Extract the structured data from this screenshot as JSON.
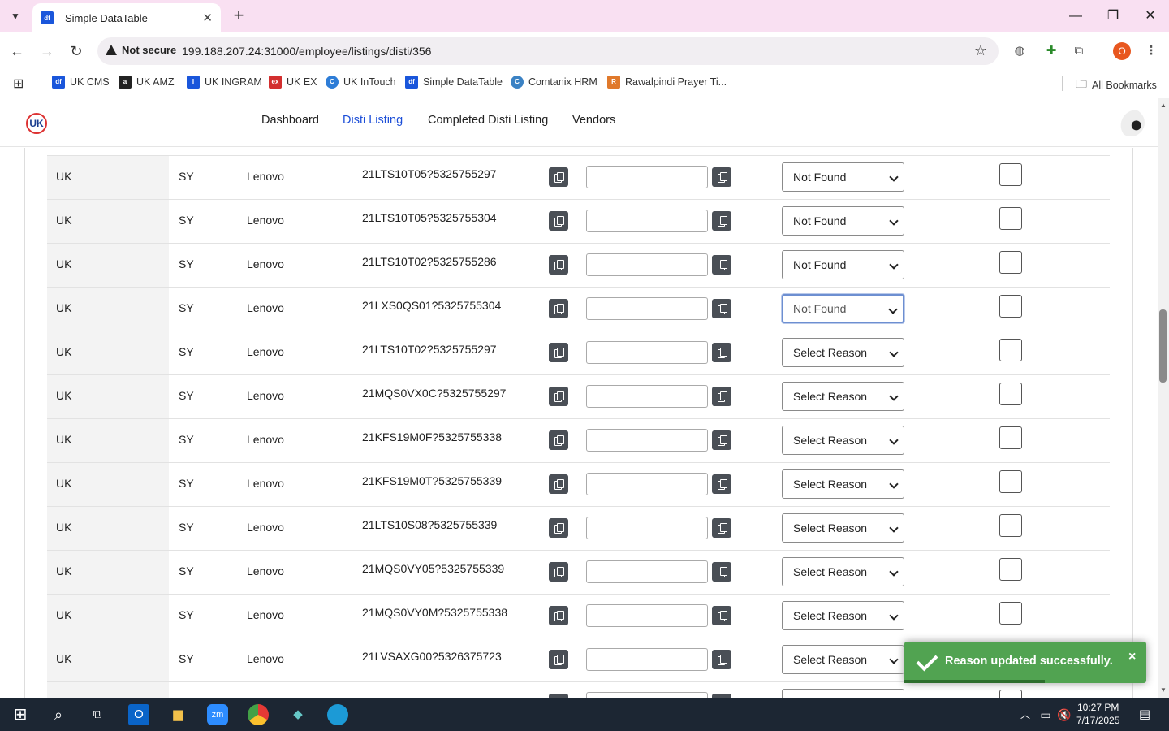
{
  "browser": {
    "tab_title": "Simple DataTable",
    "tab_favicon": "df",
    "security_label": "Not secure",
    "url": "199.188.207.24:31000/employee/listings/disti/356",
    "profile_initial": "O",
    "bookmarks": [
      {
        "label": "UK CMS",
        "icon": "df",
        "color": "#1a56db"
      },
      {
        "label": "UK AMZ",
        "icon": "a",
        "color": "#222"
      },
      {
        "label": "UK INGRAM",
        "icon": "I",
        "color": "#1a56db"
      },
      {
        "label": "UK EX",
        "icon": "ex",
        "color": "#d32f2f"
      },
      {
        "label": "UK InTouch",
        "icon": "C",
        "color": "#2e7dd7"
      },
      {
        "label": "Simple DataTable",
        "icon": "df",
        "color": "#1a56db"
      },
      {
        "label": "Comtanix HRM",
        "icon": "C",
        "color": "#3b82c4"
      },
      {
        "label": "Rawalpindi Prayer Ti...",
        "icon": "R",
        "color": "#e0792b"
      }
    ],
    "all_bookmarks": "All Bookmarks"
  },
  "site": {
    "logo": "UK",
    "nav": [
      "Dashboard",
      "Disti Listing",
      "Completed Disti Listing",
      "Vendors"
    ],
    "active_nav": "Disti Listing"
  },
  "rows": [
    {
      "country": "UK",
      "code": "SY",
      "brand": "Lenovo",
      "sku": "21LTS10T05?5325755297",
      "reason": "Not Found",
      "focused": false
    },
    {
      "country": "UK",
      "code": "SY",
      "brand": "Lenovo",
      "sku": "21LTS10T05?5325755304",
      "reason": "Not Found",
      "focused": false
    },
    {
      "country": "UK",
      "code": "SY",
      "brand": "Lenovo",
      "sku": "21LTS10T02?5325755286",
      "reason": "Not Found",
      "focused": false
    },
    {
      "country": "UK",
      "code": "SY",
      "brand": "Lenovo",
      "sku": "21LXS0QS01?5325755304",
      "reason": "Not Found",
      "focused": true
    },
    {
      "country": "UK",
      "code": "SY",
      "brand": "Lenovo",
      "sku": "21LTS10T02?5325755297",
      "reason": "Select Reason",
      "focused": false
    },
    {
      "country": "UK",
      "code": "SY",
      "brand": "Lenovo",
      "sku": "21MQS0VX0C?5325755297",
      "reason": "Select Reason",
      "focused": false
    },
    {
      "country": "UK",
      "code": "SY",
      "brand": "Lenovo",
      "sku": "21KFS19M0F?5325755338",
      "reason": "Select Reason",
      "focused": false
    },
    {
      "country": "UK",
      "code": "SY",
      "brand": "Lenovo",
      "sku": "21KFS19M0T?5325755339",
      "reason": "Select Reason",
      "focused": false
    },
    {
      "country": "UK",
      "code": "SY",
      "brand": "Lenovo",
      "sku": "21LTS10S08?5325755339",
      "reason": "Select Reason",
      "focused": false
    },
    {
      "country": "UK",
      "code": "SY",
      "brand": "Lenovo",
      "sku": "21MQS0VY05?5325755339",
      "reason": "Select Reason",
      "focused": false
    },
    {
      "country": "UK",
      "code": "SY",
      "brand": "Lenovo",
      "sku": "21MQS0VY0M?5325755338",
      "reason": "Select Reason",
      "focused": false
    },
    {
      "country": "UK",
      "code": "SY",
      "brand": "Lenovo",
      "sku": "21LVSAXG00?5326375723",
      "reason": "Select Reason",
      "focused": false
    },
    {
      "country": "",
      "code": "",
      "brand": "",
      "sku": "",
      "reason": "",
      "focused": false
    }
  ],
  "toast": {
    "message": "Reason updated successfully.",
    "close": "×",
    "progress": 0.58
  },
  "taskbar": {
    "time": "10:27 PM",
    "date": "7/17/2025"
  }
}
